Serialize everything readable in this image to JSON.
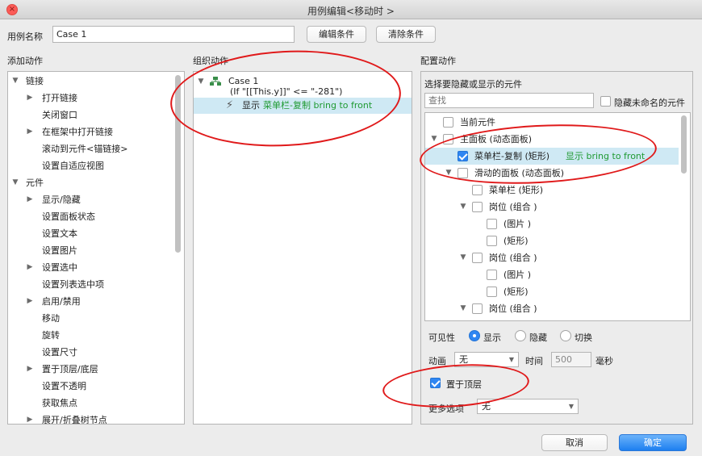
{
  "window": {
    "title": "用例编辑<移动时 >",
    "close_icon": "close-icon"
  },
  "top": {
    "case_name_label": "用例名称",
    "case_name_value": "Case 1",
    "edit_condition": "编辑条件",
    "clear_condition": "清除条件"
  },
  "add_actions": {
    "header": "添加动作",
    "items": [
      {
        "label": "链接",
        "level": 0,
        "expand": "open"
      },
      {
        "label": "打开链接",
        "level": 1,
        "expand": "closed"
      },
      {
        "label": "关闭窗口",
        "level": 1,
        "expand": "none"
      },
      {
        "label": "在框架中打开链接",
        "level": 1,
        "expand": "closed"
      },
      {
        "label": "滚动到元件<锚链接>",
        "level": 1,
        "expand": "none"
      },
      {
        "label": "设置自适应视图",
        "level": 1,
        "expand": "none"
      },
      {
        "label": "元件",
        "level": 0,
        "expand": "open"
      },
      {
        "label": "显示/隐藏",
        "level": 1,
        "expand": "closed"
      },
      {
        "label": "设置面板状态",
        "level": 1,
        "expand": "none"
      },
      {
        "label": "设置文本",
        "level": 1,
        "expand": "none"
      },
      {
        "label": "设置图片",
        "level": 1,
        "expand": "none"
      },
      {
        "label": "设置选中",
        "level": 1,
        "expand": "closed"
      },
      {
        "label": "设置列表选中项",
        "level": 1,
        "expand": "none"
      },
      {
        "label": "启用/禁用",
        "level": 1,
        "expand": "closed"
      },
      {
        "label": "移动",
        "level": 1,
        "expand": "none"
      },
      {
        "label": "旋转",
        "level": 1,
        "expand": "none"
      },
      {
        "label": "设置尺寸",
        "level": 1,
        "expand": "none"
      },
      {
        "label": "置于顶层/底层",
        "level": 1,
        "expand": "closed"
      },
      {
        "label": "设置不透明",
        "level": 1,
        "expand": "none"
      },
      {
        "label": "获取焦点",
        "level": 1,
        "expand": "none"
      },
      {
        "label": "展开/折叠树节点",
        "level": 1,
        "expand": "closed"
      }
    ]
  },
  "organize_actions": {
    "header": "组织动作",
    "case_title": "Case 1",
    "case_condition": "(If \"[[This.y]]\" <= \"-281\")",
    "action_prefix": "显示",
    "action_detail": "菜单栏-复制 bring to front"
  },
  "config_actions": {
    "header": "配置动作",
    "subheader": "选择要隐藏或显示的元件",
    "search_placeholder": "查找",
    "hide_unnamed_label": "隐藏未命名的元件",
    "tree": [
      {
        "label": "当前元件",
        "indent": 0,
        "expand": "none",
        "checked": false,
        "extra": ""
      },
      {
        "label": "主面板 (动态面板)",
        "indent": 0,
        "expand": "open",
        "checked": false,
        "extra": ""
      },
      {
        "label": "菜单栏-复制 (矩形)",
        "indent": 1,
        "expand": "none",
        "checked": true,
        "extra": "显示 bring to front",
        "selected": true
      },
      {
        "label": "滑动的面板 (动态面板)",
        "indent": 1,
        "expand": "open",
        "checked": false,
        "extra": ""
      },
      {
        "label": "菜单栏 (矩形)",
        "indent": 2,
        "expand": "none",
        "checked": false,
        "extra": ""
      },
      {
        "label": "岗位 (组合 )",
        "indent": 2,
        "expand": "open",
        "checked": false,
        "extra": ""
      },
      {
        "label": "(图片 )",
        "indent": 3,
        "expand": "none",
        "checked": false,
        "extra": ""
      },
      {
        "label": "(矩形)",
        "indent": 3,
        "expand": "none",
        "checked": false,
        "extra": ""
      },
      {
        "label": "岗位 (组合 )",
        "indent": 2,
        "expand": "open",
        "checked": false,
        "extra": ""
      },
      {
        "label": "(图片 )",
        "indent": 3,
        "expand": "none",
        "checked": false,
        "extra": ""
      },
      {
        "label": "(矩形)",
        "indent": 3,
        "expand": "none",
        "checked": false,
        "extra": ""
      },
      {
        "label": "岗位 (组合 )",
        "indent": 2,
        "expand": "open",
        "checked": false,
        "extra": ""
      }
    ],
    "visibility_label": "可见性",
    "visibility_options": [
      "显示",
      "隐藏",
      "切换"
    ],
    "visibility_selected": "显示",
    "animation_label": "动画",
    "animation_value": "无",
    "time_label": "时间",
    "time_value": "500",
    "time_unit": "毫秒",
    "bring_to_front_label": "置于顶层",
    "bring_to_front_checked": true,
    "more_options_label": "更多选项",
    "more_options_value": "无"
  },
  "footer": {
    "cancel": "取消",
    "ok": "确定"
  }
}
